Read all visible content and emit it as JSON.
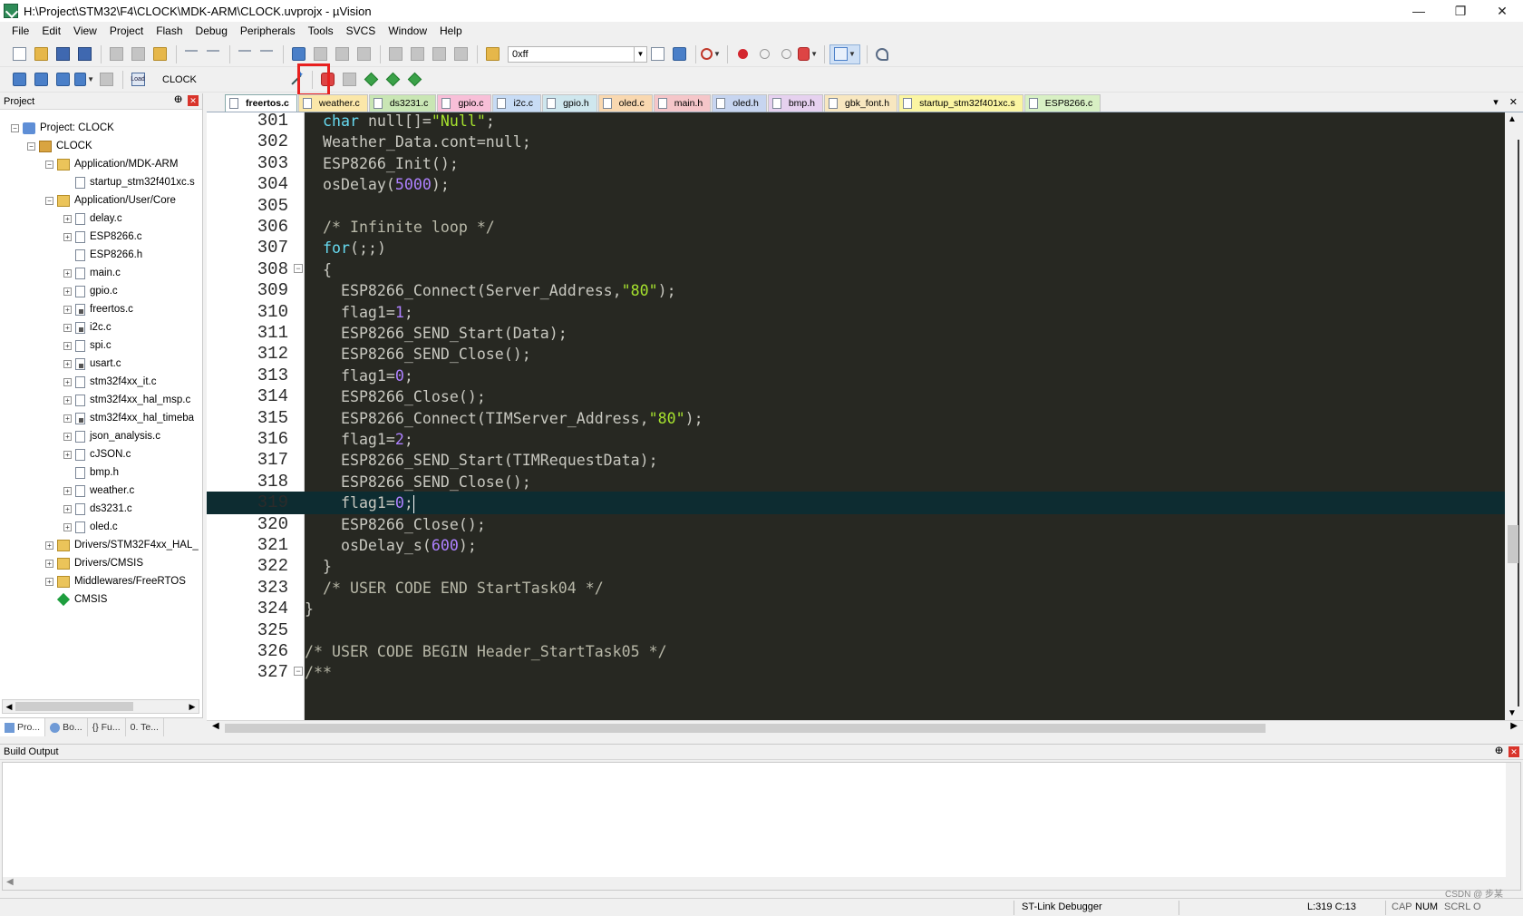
{
  "window": {
    "title": "H:\\Project\\STM32\\F4\\CLOCK\\MDK-ARM\\CLOCK.uvprojx - µVision",
    "min": "—",
    "restore": "❐",
    "close": "✕"
  },
  "menu": [
    "File",
    "Edit",
    "View",
    "Project",
    "Flash",
    "Debug",
    "Peripherals",
    "Tools",
    "SVCS",
    "Window",
    "Help"
  ],
  "toolbar": {
    "search_value": "0xff",
    "target_name": "CLOCK",
    "load_label": "Load",
    "highlight_color": "#e8201f"
  },
  "project_panel": {
    "title": "Project",
    "pin": "ⴲ",
    "close": "✕",
    "tree": [
      {
        "label": "Project: CLOCK",
        "icon": "project-icon",
        "level": 0,
        "exp": "−"
      },
      {
        "label": "CLOCK",
        "icon": "target-icon",
        "level": 1,
        "exp": "−"
      },
      {
        "label": "Application/MDK-ARM",
        "icon": "folder-icon",
        "level": 2,
        "exp": "−"
      },
      {
        "label": "startup_stm32f401xc.s",
        "icon": "file-icon",
        "level": 3,
        "exp": ""
      },
      {
        "label": "Application/User/Core",
        "icon": "folder-icon",
        "level": 2,
        "exp": "−"
      },
      {
        "label": "delay.c",
        "icon": "file-icon",
        "level": 3,
        "exp": "+"
      },
      {
        "label": "ESP8266.c",
        "icon": "file-icon",
        "level": 3,
        "exp": "+"
      },
      {
        "label": "ESP8266.h",
        "icon": "file-icon",
        "level": 3,
        "exp": ""
      },
      {
        "label": "main.c",
        "icon": "file-icon",
        "level": 3,
        "exp": "+"
      },
      {
        "label": "gpio.c",
        "icon": "file-icon",
        "level": 3,
        "exp": "+"
      },
      {
        "label": "freertos.c",
        "icon": "locked-file-icon",
        "level": 3,
        "exp": "+"
      },
      {
        "label": "i2c.c",
        "icon": "locked-file-icon",
        "level": 3,
        "exp": "+"
      },
      {
        "label": "spi.c",
        "icon": "file-icon",
        "level": 3,
        "exp": "+"
      },
      {
        "label": "usart.c",
        "icon": "locked-file-icon",
        "level": 3,
        "exp": "+"
      },
      {
        "label": "stm32f4xx_it.c",
        "icon": "file-icon",
        "level": 3,
        "exp": "+"
      },
      {
        "label": "stm32f4xx_hal_msp.c",
        "icon": "file-icon",
        "level": 3,
        "exp": "+"
      },
      {
        "label": "stm32f4xx_hal_timeba",
        "icon": "locked-file-icon",
        "level": 3,
        "exp": "+"
      },
      {
        "label": "json_analysis.c",
        "icon": "file-icon",
        "level": 3,
        "exp": "+"
      },
      {
        "label": "cJSON.c",
        "icon": "file-icon",
        "level": 3,
        "exp": "+"
      },
      {
        "label": "bmp.h",
        "icon": "file-icon",
        "level": 3,
        "exp": ""
      },
      {
        "label": "weather.c",
        "icon": "file-icon",
        "level": 3,
        "exp": "+"
      },
      {
        "label": "ds3231.c",
        "icon": "file-icon",
        "level": 3,
        "exp": "+"
      },
      {
        "label": "oled.c",
        "icon": "file-icon",
        "level": 3,
        "exp": "+"
      },
      {
        "label": "Drivers/STM32F4xx_HAL_",
        "icon": "folder-icon",
        "level": 2,
        "exp": "+"
      },
      {
        "label": "Drivers/CMSIS",
        "icon": "folder-icon",
        "level": 2,
        "exp": "+"
      },
      {
        "label": "Middlewares/FreeRTOS",
        "icon": "folder-icon",
        "level": 2,
        "exp": "+"
      },
      {
        "label": "CMSIS",
        "icon": "cmsis-icon",
        "level": 2,
        "exp": ""
      }
    ],
    "tabs": [
      "Pro...",
      "Bo...",
      "{} Fu...",
      "0. Te..."
    ]
  },
  "editor": {
    "tabs": [
      {
        "label": "freertos.c",
        "color": "#ffffff",
        "active": true
      },
      {
        "label": "weather.c",
        "color": "#fbe7a9",
        "active": false
      },
      {
        "label": "ds3231.c",
        "color": "#c9e6b4",
        "active": false
      },
      {
        "label": "gpio.c",
        "color": "#f8bfd8",
        "active": false
      },
      {
        "label": "i2c.c",
        "color": "#c8dcf5",
        "active": false
      },
      {
        "label": "gpio.h",
        "color": "#cfe7ee",
        "active": false
      },
      {
        "label": "oled.c",
        "color": "#f9d8b0",
        "active": false
      },
      {
        "label": "main.h",
        "color": "#f5c6c9",
        "active": false
      },
      {
        "label": "oled.h",
        "color": "#c7d5f0",
        "active": false
      },
      {
        "label": "bmp.h",
        "color": "#e6d1ef",
        "active": false
      },
      {
        "label": "gbk_font.h",
        "color": "#f8e7c0",
        "active": false
      },
      {
        "label": "startup_stm32f401xc.s",
        "color": "#fbf5a2",
        "active": false
      },
      {
        "label": "ESP8266.c",
        "color": "#d8f0c4",
        "active": false
      }
    ],
    "tabs_dropdown": "▾",
    "tabs_close": "✕",
    "current_line": "319",
    "lines": [
      {
        "n": "301",
        "fold": "",
        "html": "  <span class=\"kw\">char</span> null[]=<span class=\"str\">\"Null\"</span>;"
      },
      {
        "n": "302",
        "fold": "",
        "html": "  Weather_Data.cont=null;"
      },
      {
        "n": "303",
        "fold": "",
        "html": "  ESP8266_Init();"
      },
      {
        "n": "304",
        "fold": "",
        "html": "  osDelay(<span class=\"num\">5000</span>);"
      },
      {
        "n": "305",
        "fold": "",
        "html": ""
      },
      {
        "n": "306",
        "fold": "",
        "html": "  <span class=\"cmt\">/* Infinite loop */</span>"
      },
      {
        "n": "307",
        "fold": "",
        "html": "  <span class=\"kw\">for</span>(;;)"
      },
      {
        "n": "308",
        "fold": "−",
        "html": "  {"
      },
      {
        "n": "309",
        "fold": "",
        "html": "    ESP8266_Connect(Server_Address,<span class=\"str\">\"80\"</span>);"
      },
      {
        "n": "310",
        "fold": "",
        "html": "    flag1=<span class=\"num\">1</span>;"
      },
      {
        "n": "311",
        "fold": "",
        "html": "    ESP8266_SEND_Start(Data);"
      },
      {
        "n": "312",
        "fold": "",
        "html": "    ESP8266_SEND_Close();"
      },
      {
        "n": "313",
        "fold": "",
        "html": "    flag1=<span class=\"num\">0</span>;"
      },
      {
        "n": "314",
        "fold": "",
        "html": "    ESP8266_Close();"
      },
      {
        "n": "315",
        "fold": "",
        "html": "    ESP8266_Connect(TIMServer_Address,<span class=\"str\">\"80\"</span>);"
      },
      {
        "n": "316",
        "fold": "",
        "html": "    flag1=<span class=\"num\">2</span>;"
      },
      {
        "n": "317",
        "fold": "",
        "html": "    ESP8266_SEND_Start(TIMRequestData);"
      },
      {
        "n": "318",
        "fold": "",
        "html": "    ESP8266_SEND_Close();"
      },
      {
        "n": "319",
        "fold": "",
        "html": "    flag1=<span class=\"num\">0</span>;<span class=\"caret\"></span>"
      },
      {
        "n": "320",
        "fold": "",
        "html": "    ESP8266_Close();"
      },
      {
        "n": "321",
        "fold": "",
        "html": "    osDelay_s(<span class=\"num\">600</span>);"
      },
      {
        "n": "322",
        "fold": "",
        "html": "  }"
      },
      {
        "n": "323",
        "fold": "",
        "html": "  <span class=\"cmt\">/* USER CODE END StartTask04 */</span>"
      },
      {
        "n": "324",
        "fold": "",
        "html": "}"
      },
      {
        "n": "325",
        "fold": "",
        "html": ""
      },
      {
        "n": "326",
        "fold": "",
        "html": "<span class=\"cmt\">/* USER CODE BEGIN Header_StartTask05 */</span>"
      },
      {
        "n": "327",
        "fold": "−",
        "html": "<span class=\"cmt\">/**</span>"
      }
    ]
  },
  "build_output": {
    "title": "Build Output",
    "pin": "ⴲ",
    "close": "✕"
  },
  "status": {
    "debugger": "ST-Link Debugger",
    "position": "L:319 C:13",
    "cap": "CAP",
    "num": "NUM",
    "scrl": "SCRL",
    "ovr": "O",
    "watermark": "CSDN @ 步某"
  }
}
